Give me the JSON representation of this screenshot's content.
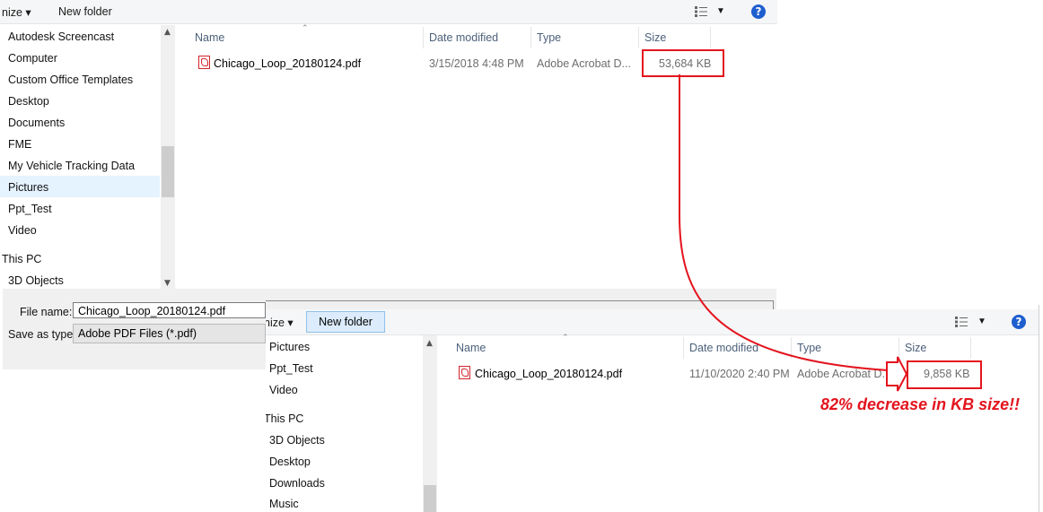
{
  "top_window": {
    "toolbar": {
      "organize_label": "nize",
      "new_folder_label": "New folder",
      "help_label": "?"
    },
    "nav_items": [
      "Autodesk Screencast",
      "Computer",
      "Custom Office Templates",
      "Desktop",
      "Documents",
      "FME",
      "My Vehicle Tracking Data",
      "Pictures",
      "Ppt_Test",
      "Video",
      "This PC",
      "3D Objects"
    ],
    "selected_nav": "Pictures",
    "columns": {
      "name": "Name",
      "date": "Date modified",
      "type": "Type",
      "size": "Size"
    },
    "file": {
      "name": "Chicago_Loop_20180124.pdf",
      "date": "3/15/2018 4:48 PM",
      "type": "Adobe Acrobat D...",
      "size": "53,684 KB"
    }
  },
  "save_panel": {
    "file_name_label": "File name:",
    "file_name_value": "Chicago_Loop_20180124.pdf",
    "save_type_label": "Save as type:",
    "save_type_value": "Adobe PDF Files (*.pdf)"
  },
  "bottom_window": {
    "toolbar": {
      "organize_label": "nize",
      "new_folder_label": "New folder",
      "help_label": "?"
    },
    "nav_items": [
      "Pictures",
      "Ppt_Test",
      "Video",
      "This PC",
      "3D Objects",
      "Desktop",
      "Downloads",
      "Music"
    ],
    "columns": {
      "name": "Name",
      "date": "Date modified",
      "type": "Type",
      "size": "Size"
    },
    "file": {
      "name": "Chicago_Loop_20180124.pdf",
      "date": "11/10/2020 2:40 PM",
      "type": "Adobe Acrobat D...",
      "size": "9,858 KB"
    }
  },
  "annotation": {
    "text": "82% decrease in KB size!!",
    "color": "#e3141e"
  },
  "colors": {
    "accent_blue": "#1e5fcf",
    "selection": "#e5f3ff",
    "annotation_red": "#e3141e"
  }
}
